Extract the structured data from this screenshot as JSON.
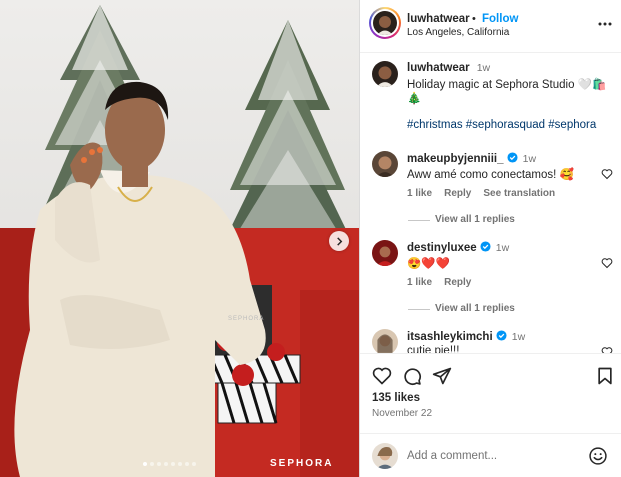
{
  "post": {
    "brand_watermark": "SEPHORA",
    "carousel": {
      "count": 8,
      "active": 0
    }
  },
  "header": {
    "username": "luwhatwear",
    "separator": "•",
    "follow_label": "Follow",
    "location": "Los Angeles, California"
  },
  "caption": {
    "username": "luwhatwear",
    "time": "1w",
    "text_line1": "Holiday magic at Sephora Studio 🤍🛍️",
    "text_line2": "🎄",
    "hashtags": "#christmas #sephorasquad #sephora"
  },
  "comments": [
    {
      "username": "makeupbyjenniii_",
      "time": "1w",
      "text": "Aww amé como conectamos! 🥰",
      "likes": "1 like",
      "reply": "Reply",
      "translate": "See translation",
      "view_replies": "View all 1 replies"
    },
    {
      "username": "destinyluxee",
      "time": "1w",
      "text": "😍❤️❤️",
      "likes": "1 like",
      "reply": "Reply",
      "view_replies": "View all 1 replies"
    },
    {
      "username": "itsashleykimchi",
      "time": "1w",
      "text": "cutie pie!!!"
    }
  ],
  "footer": {
    "likes": "135 likes",
    "date": "November 22",
    "comment_placeholder": "Add a comment..."
  },
  "colors": {
    "link": "#0095f6",
    "hashtag": "#00376b",
    "muted": "#737373"
  }
}
